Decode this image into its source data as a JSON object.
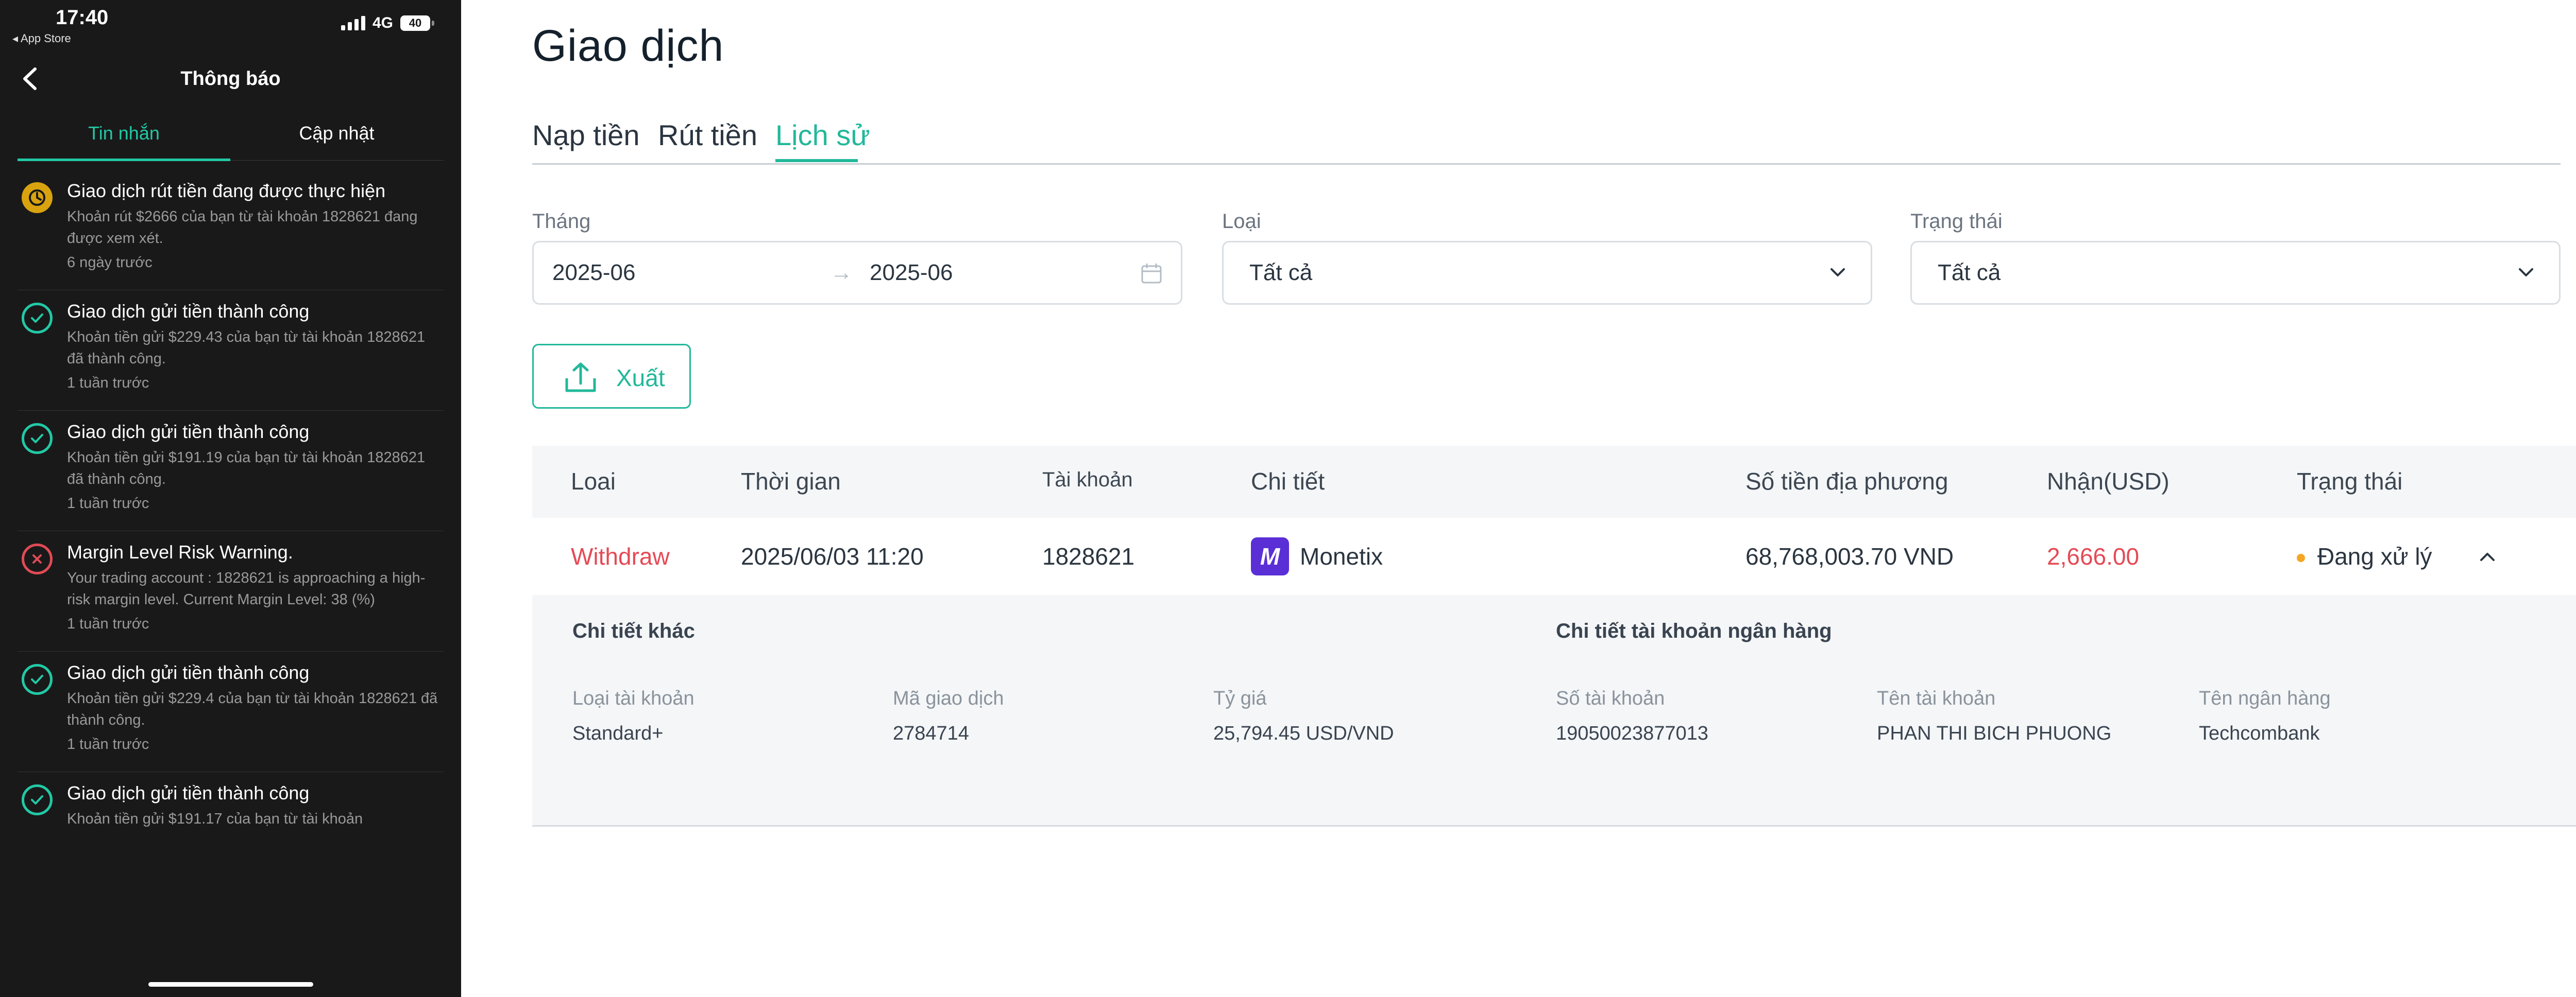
{
  "phone": {
    "status_bar": {
      "time": "17:40",
      "back_app": "◂ App Store",
      "network": "4G",
      "battery": "40"
    },
    "nav": {
      "title": "Thông báo"
    },
    "tabs": [
      {
        "label": "Tin nhắn"
      },
      {
        "label": "Cập nhật"
      }
    ],
    "notifications": [
      {
        "status": "pending",
        "title": "Giao dịch rút tiền đang được thực hiện",
        "body": "Khoản rút $2666 của bạn từ tài khoản 1828621 đang được xem xét.",
        "time": "6 ngày trước"
      },
      {
        "status": "success",
        "title": "Giao dịch gửi tiền thành công",
        "body": "Khoản tiền gửi $229.43 của bạn từ tài khoản 1828621 đã thành công.",
        "time": "1 tuần trước"
      },
      {
        "status": "success",
        "title": "Giao dịch gửi tiền thành công",
        "body": "Khoản tiền gửi $191.19 của bạn từ tài khoản 1828621 đã thành công.",
        "time": "1 tuần trước"
      },
      {
        "status": "error",
        "title": "Margin Level Risk Warning.",
        "body": "Your trading account : 1828621  is approaching a high-risk margin level. Current Margin Level: 38 (%)",
        "time": "1 tuần trước"
      },
      {
        "status": "success",
        "title": "Giao dịch gửi tiền thành công",
        "body": "Khoản tiền gửi $229.4 của bạn từ tài khoản 1828621 đã thành công.",
        "time": "1 tuần trước"
      },
      {
        "status": "success",
        "title": "Giao dịch gửi tiền thành công",
        "body": "Khoản tiền gửi $191.17 của bạn từ tài khoản",
        "time": ""
      }
    ]
  },
  "web": {
    "title": "Giao dịch",
    "tabs": [
      {
        "label": "Nạp tiền"
      },
      {
        "label": "Rút tiền"
      },
      {
        "label": "Lịch sử"
      }
    ],
    "active_tab": "Lịch sử",
    "filters": {
      "month": {
        "label": "Tháng",
        "from": "2025-06",
        "to": "2025-06",
        "arrow": "→"
      },
      "type": {
        "label": "Loại",
        "value": "Tất cả"
      },
      "status": {
        "label": "Trạng thái",
        "value": "Tất cả"
      }
    },
    "export_label": "Xuất",
    "table": {
      "headers": [
        "Loai",
        "Thời gian",
        "Tài khoản",
        "Chi tiết",
        "Số tiền địa phương",
        "Nhận(USD)",
        "Trạng thái"
      ],
      "rows": [
        {
          "type": "Withdraw",
          "time": "2025/06/03 11:20",
          "account": "1828621",
          "detail_logo": "M",
          "detail": "Monetix",
          "local_amount": "68,768,003.70 VND",
          "usd": "2,666.00",
          "status": "Đang xử lý"
        }
      ]
    },
    "details": {
      "other_heading": "Chi tiết khác",
      "bank_heading": "Chi tiết tài khoản ngân hàng",
      "fields": [
        {
          "label": "Loại tài khoản",
          "value": "Standard+"
        },
        {
          "label": "Mã giao dịch",
          "value": "2784714"
        },
        {
          "label": "Tỷ giá",
          "value": "25,794.45 USD/VND"
        },
        {
          "label": "Số tài khoản",
          "value": "19050023877013"
        },
        {
          "label": "Tên tài khoản",
          "value": "PHAN THI BICH PHUONG"
        },
        {
          "label": "Tên ngân hàng",
          "value": "Techcombank"
        }
      ]
    }
  },
  "colors": {
    "accent": "#22b89a",
    "mobile_accent": "#22c9a6",
    "danger": "#e54a55",
    "pending": "#f5a623",
    "phone_bg": "#191919"
  },
  "icons": [
    "signal-icon",
    "battery-icon",
    "back-chevron-icon",
    "pending-clock-icon",
    "check-circle-icon",
    "x-circle-icon",
    "calendar-icon",
    "chevron-down-icon",
    "upload-icon",
    "monetix-logo",
    "chevron-up-icon"
  ]
}
